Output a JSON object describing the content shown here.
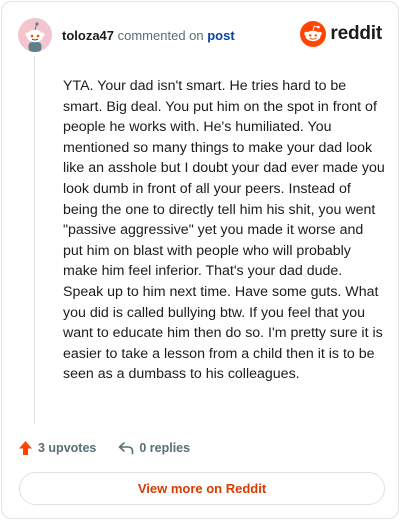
{
  "header": {
    "username": "toloza47",
    "action_text": " commented on ",
    "post_link": "post"
  },
  "logo": {
    "text": "reddit",
    "icon": "reddit-snoo-icon"
  },
  "comment": {
    "body": "YTA. Your dad isn't smart. He tries hard to be smart. Big deal. You put him on the spot in front of people he works with. He's humiliated. You mentioned so many things to make your dad look like an asshole but I doubt your dad ever made you look dumb in front of all your peers. Instead of being the one to directly tell him his shit, you went \"passive aggressive\" yet you made it worse and put him on blast with people who will probably make him feel inferior. That's your dad dude. Speak up to him next time. Have some guts. What you did is called bullying btw. If you feel that you want to educate him then do so. I'm pretty sure it is easier to take a lesson from a child then it is to be seen as a dumbass to his colleagues."
  },
  "actions": {
    "upvotes": "3 upvotes",
    "replies": "0 replies",
    "upvote_icon": "upvote-arrow-icon",
    "reply_icon": "reply-arrow-icon"
  },
  "footer": {
    "view_more": "View more on Reddit"
  },
  "colors": {
    "brand": "#ff4500",
    "link": "#0a449b",
    "view_more": "#d93a00",
    "muted": "#576f76"
  }
}
